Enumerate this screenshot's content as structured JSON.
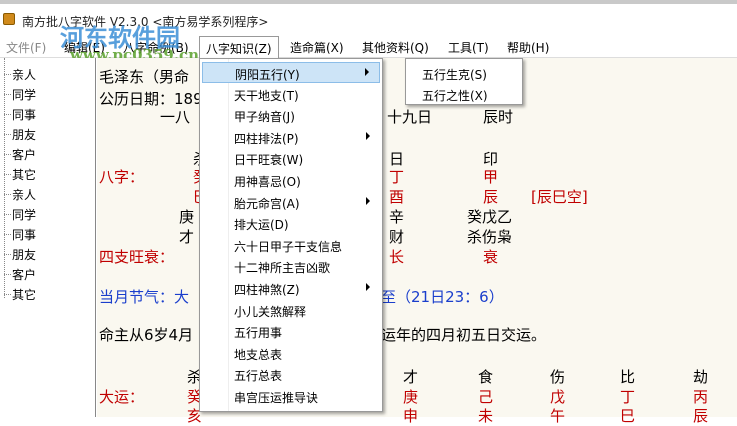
{
  "window": {
    "title": "南方批八字软件 V2.3.0   <南方易学系列程序>"
  },
  "watermark": {
    "name": "河东软件园",
    "url": "www.pc0359.cn"
  },
  "menubar": [
    "文件(F)",
    "编辑(E)",
    "八字命例(B)",
    "八字知识(Z)",
    "造命篇(X)",
    "其他资料(Q)",
    "工具(T)",
    "帮助(H)"
  ],
  "sidebar": [
    "亲人",
    "同学",
    "同事",
    "朋友",
    "客户",
    "其它",
    "亲人",
    "同学",
    "同事",
    "朋友",
    "客户",
    "其它"
  ],
  "dropdown": [
    "阴阳五行(Y)",
    "天干地支(T)",
    "甲子纳音(J)",
    "四柱排法(P)",
    "日干旺衰(W)",
    "用神喜忌(O)",
    "胎元命宫(A)",
    "排大运(D)",
    "六十日甲子干支信息",
    "十二神所主吉凶歌",
    "四柱神煞(Z)",
    "小儿关煞解释",
    "五行用事",
    "地支总表",
    "五行总表",
    "串宫压运推导诀"
  ],
  "submenu": [
    "五行生克(S)",
    "五行之性(X)"
  ],
  "content": {
    "name": "毛泽东（男命",
    "date": "公历日期：189",
    "lunar_a": "一八",
    "lunar_b": "十九日",
    "lunar_c": "辰时",
    "h1": "日",
    "h2": "印",
    "h0": "杀",
    "bazi_label": "八字：",
    "g1": "丁",
    "g2": "甲",
    "g0": "癸",
    "z1": "酉",
    "z2": "辰",
    "z0": "巳",
    "kong": "[辰巳空]",
    "cg0": "庚",
    "cg1": "辛",
    "cg2": "癸戊乙",
    "ss0": "才",
    "ss1": "财",
    "ss2": "杀伤枭",
    "ws_label": "四支旺衰：",
    "ws1": "长",
    "ws2": "衰",
    "jieqi_a": "当月节气：大",
    "jieqi_b": "至（21日23：6）",
    "yun_a": "命主从6岁4月",
    "yun_b": "运年的四月初五日交运。",
    "dy_label": "大运：",
    "dy_shen": [
      "杀",
      "才",
      "食",
      "伤",
      "比",
      "劫"
    ],
    "dy_gan": [
      "癸",
      "庚",
      "己",
      "戊",
      "丁",
      "丙"
    ],
    "dy_zhi": [
      "亥",
      "申",
      "未",
      "午",
      "巳",
      "辰"
    ]
  }
}
